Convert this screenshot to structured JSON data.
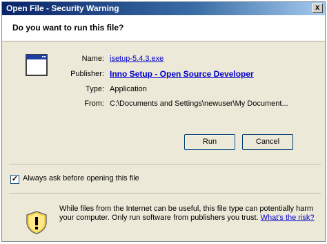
{
  "window": {
    "title": "Open File - Security Warning",
    "close_label": "x"
  },
  "heading": "Do you want to run this file?",
  "fields": {
    "name_label": "Name:",
    "name_value": "isetup-5.4.3.exe",
    "publisher_label": "Publisher:",
    "publisher_value": "Inno Setup - Open Source Developer",
    "type_label": "Type:",
    "type_value": "Application",
    "from_label": "From:",
    "from_value": "C:\\Documents and Settings\\newuser\\My Document..."
  },
  "buttons": {
    "run": "Run",
    "cancel": "Cancel"
  },
  "checkbox": {
    "checked": true,
    "label": "Always ask before opening this file"
  },
  "warning": {
    "text": "While files from the Internet can be useful, this file type can potentially harm your computer. Only run software from publishers you trust. ",
    "link": "What's the risk?"
  },
  "icons": {
    "app": "application-window-icon",
    "shield": "security-shield-icon"
  },
  "colors": {
    "link": "#0000cc",
    "title_bar": "#0a246a",
    "dialog_bg": "#ece9d8"
  }
}
